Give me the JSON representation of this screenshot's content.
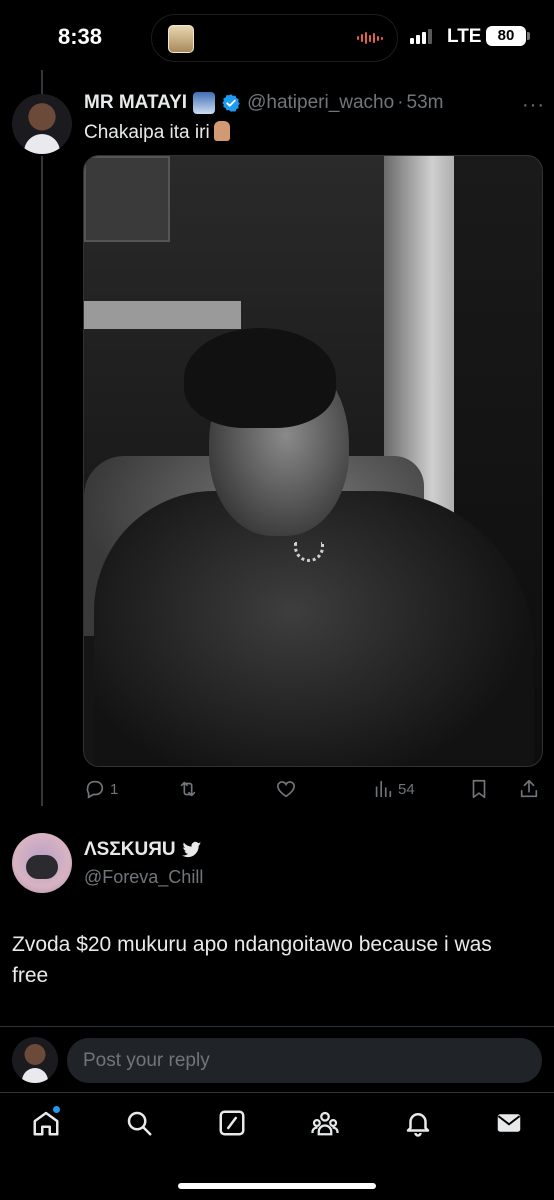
{
  "status_bar": {
    "time": "8:38",
    "network": "LTE",
    "battery": "80"
  },
  "tweet": {
    "display_name": "MR MATAYI",
    "name_emoji": "man-in-suit-emoji",
    "handle": "@hatiperi_wacho",
    "separator": "·",
    "age": "53m",
    "text": "Chakaipa ita iri",
    "text_emoji": "pointing-down-emoji",
    "image_description_icon": "photo",
    "actions": {
      "replies": "1",
      "retweets": "",
      "likes": "",
      "views": "54"
    },
    "verified_color": "#1d9bf0"
  },
  "reply": {
    "display_name": "ΛSΣKUЯU",
    "handle": "@Foreva_Chill",
    "text": "Zvoda $20 mukuru apo ndangoitawo because i was free"
  },
  "compose": {
    "placeholder": "Post your reply"
  },
  "nav": {
    "items": [
      "home-icon",
      "search-icon",
      "grok-icon",
      "communities-icon",
      "notifications-icon",
      "messages-icon"
    ],
    "active": "home-icon",
    "notification_dot_color": "#1d9bf0"
  },
  "colors": {
    "background": "#000000",
    "text": "#e7e9ea",
    "muted": "#71767b",
    "accent": "#1d9bf0"
  }
}
